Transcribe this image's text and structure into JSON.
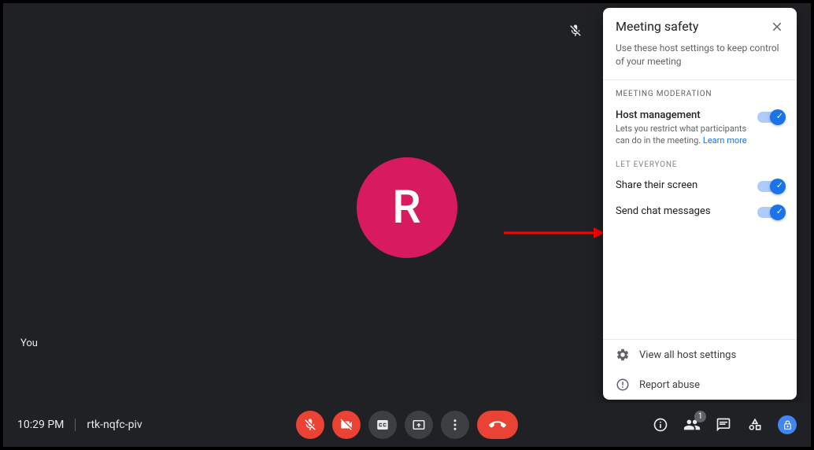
{
  "video": {
    "avatar_letter": "R",
    "you_label": "You"
  },
  "bottom": {
    "time": "10:29 PM",
    "meeting_code": "rtk-nqfc-piv",
    "participants_count": "1"
  },
  "panel": {
    "title": "Meeting safety",
    "description": "Use these host settings to keep control of your meeting",
    "section_moderation": "MEETING MODERATION",
    "host_management_label": "Host management",
    "host_management_sub": "Lets you restrict what participants can do in the meeting.",
    "learn_more": "Learn more",
    "let_everyone": "LET EVERYONE",
    "share_screen": "Share their screen",
    "send_chat": "Send chat messages",
    "view_all": "View all host settings",
    "report_abuse": "Report abuse"
  },
  "colors": {
    "accent": "#1a73e8",
    "danger": "#ea4335",
    "avatar": "#d81b60"
  }
}
